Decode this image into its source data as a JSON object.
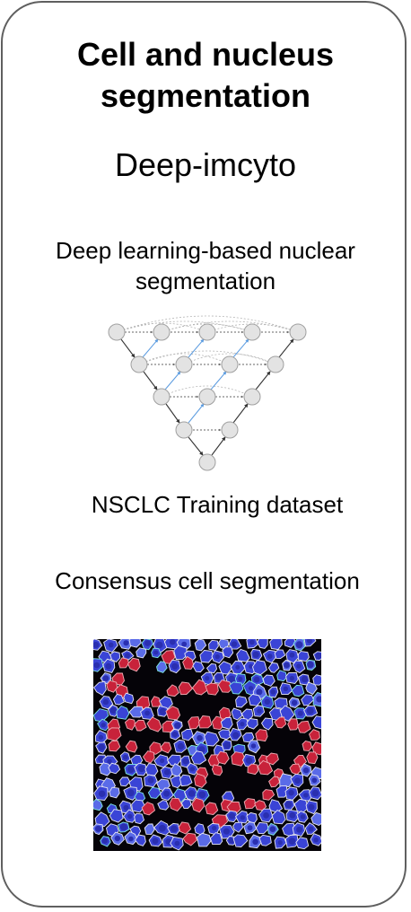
{
  "title_lines": [
    "Cell and nucleus",
    "segmentation"
  ],
  "subtitle": "Deep-imcyto",
  "sections": {
    "deep_learning_lines": [
      "Deep learning-based nuclear",
      "segmentation"
    ],
    "training_dataset": "NSCLC Training dataset",
    "consensus": "Consensus cell segmentation"
  },
  "icons": {
    "network": "unet-architecture-diagram-icon",
    "image": "cell-segmentation-micrograph-icon"
  },
  "colors": {
    "border": "#5f5f5f",
    "node_fill": "#e3e3e3",
    "node_stroke": "#a0a0a0",
    "skip_arrow": "#888888",
    "up_arrow": "#7fb2e5",
    "down_arrow": "#333333",
    "micrograph_bg": "#050308",
    "nucleus_blue": "#3848d8",
    "membrane_red": "#d3283a"
  }
}
